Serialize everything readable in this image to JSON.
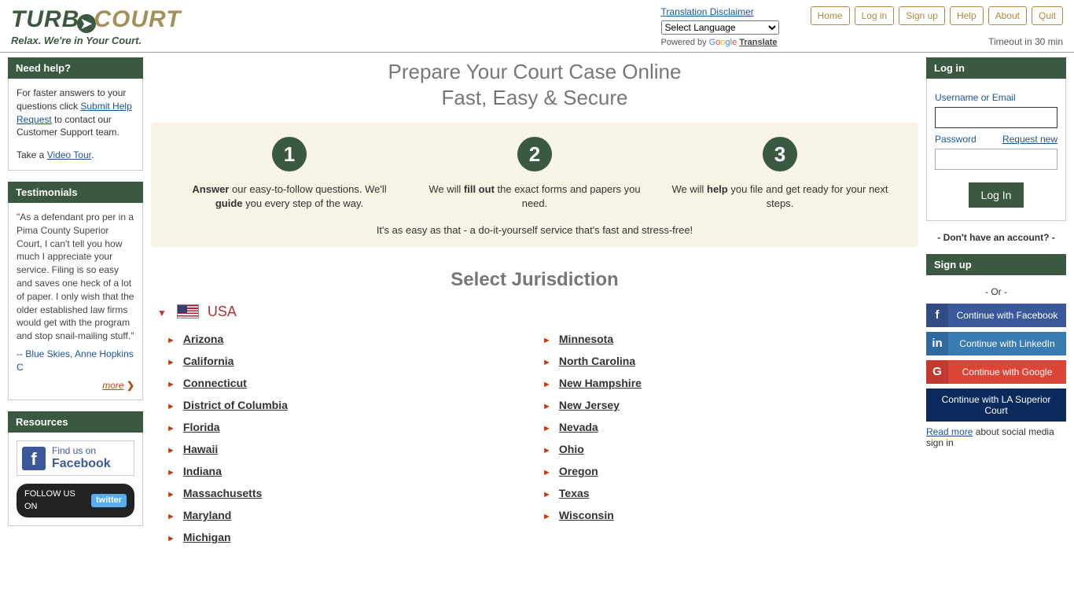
{
  "logo": {
    "part1": "TURB",
    "part2": "COURT",
    "tagline": "Relax.  We're in Your Court."
  },
  "header": {
    "disclaimer": "Translation Disclaimer",
    "lang_default": "Select Language",
    "powered": "Powered by",
    "translate": "Translate",
    "nav": {
      "home": "Home",
      "login": "Log in",
      "signup": "Sign up",
      "help": "Help",
      "about": "About",
      "quit": "Quit"
    },
    "timeout": "Timeout in 30 min"
  },
  "help_box": {
    "title": "Need help?",
    "text1": "For faster answers to your questions click ",
    "link1": "Submit Help Request",
    "text2": " to contact our Customer Support team.",
    "text3": "Take a ",
    "link2": "Video Tour",
    "period": "."
  },
  "testimonials": {
    "title": "Testimonials",
    "quote": "\"As a defendant pro per in a Pima County Superior Court, I can't tell you how much I appreciate your service. Filing is so easy and saves one heck of a lot of paper. I only wish that the older established law firms would get with the program and stop snail-mailing stuff.\"",
    "attrib": "-- Blue Skies, Anne Hopkins C",
    "more": "more"
  },
  "resources": {
    "title": "Resources",
    "fb_line1": "Find us on",
    "fb_line2": "Facebook",
    "tw_prefix": "FOLLOW US ON",
    "tw": "twitter"
  },
  "main": {
    "title_l1": "Prepare Your Court Case Online",
    "title_l2": "Fast, Easy & Secure",
    "step1": "Answer our easy-to-follow questions. We'll guide you every step of the way.",
    "step2": "We will fill out the exact forms and papers you need.",
    "step3": "We will help you file and get ready for your next steps.",
    "steps_foot": "It's as easy as that - a do-it-yourself service that's fast and stress-free!",
    "section": "Select Jurisdiction",
    "country": "USA",
    "left": [
      "Arizona",
      "California",
      "Connecticut",
      "District of Columbia",
      "Florida",
      "Hawaii",
      "Indiana",
      "Massachusetts",
      "Maryland",
      "Michigan"
    ],
    "right": [
      "Minnesota",
      "North Carolina",
      "New Hampshire",
      "New Jersey",
      "Nevada",
      "Ohio",
      "Oregon",
      "Texas",
      "Wisconsin"
    ]
  },
  "login": {
    "title": "Log in",
    "user_label": "Username or Email",
    "pass_label": "Password",
    "request_new": "Request new",
    "button": "Log In",
    "noacct": "- Don't have an account? -"
  },
  "signup": {
    "title": "Sign up",
    "or": "- Or -",
    "fb": "Continue with Facebook",
    "li": "Continue with LinkedIn",
    "gg": "Continue with Google",
    "la": "Continue with LA Superior Court",
    "read_more": "Read more",
    "read_more_tail": " about social media sign in"
  }
}
